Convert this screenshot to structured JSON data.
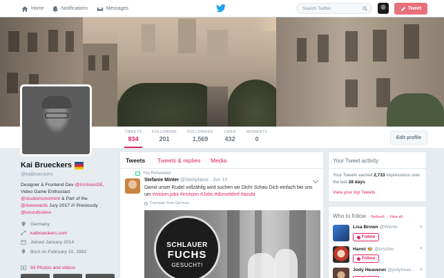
{
  "nav": {
    "home": "Home",
    "notifications": "Notifications",
    "messages": "Messages",
    "search_placeholder": "Search Twitter",
    "tweet_button": "Tweet"
  },
  "stats": [
    {
      "label": "TWEETS",
      "value": "834"
    },
    {
      "label": "FOLLOWING",
      "value": "201"
    },
    {
      "label": "FOLLOWERS",
      "value": "1,569"
    },
    {
      "label": "LIKES",
      "value": "432"
    },
    {
      "label": "MOMENTS",
      "value": "0"
    }
  ],
  "edit_profile": "Edit profile",
  "profile": {
    "name": "Kai Brueckers",
    "handle": "@kaibrueckers",
    "bio_1": "Designer & Frontend Dev ",
    "bio_link_1": "@InVisionDE",
    "bio_2": ", Video Game Enthusiast ",
    "bio_link_2": "@studiomonoment",
    "bio_3": " & Part of the ",
    "bio_link_3": "@Awwwards",
    "bio_4": " Jury 2017 /// Previously ",
    "bio_link_4": "@uxundtoilere",
    "location": "Germany",
    "website": "kaibrueckers.com",
    "joined": "Joined January 2014",
    "born": "Born on February 10, 1992",
    "photos": "93 Photos and videos"
  },
  "timeline": {
    "tabs": [
      "Tweets",
      "Tweets & replies",
      "Media"
    ],
    "retweeted": "You Retweeted",
    "tweet": {
      "author": "Stefanie Minter",
      "handle": "@Stehpfanni",
      "date": "Jun 13",
      "text_1": "Damit unser Rudel vollzählig wird suchen wir Dich! Schau Dich einfach bei uns um ",
      "link_1": "invision.jobs",
      "link_2": "#invision",
      "link_3": "#Jobs",
      "link_4": "#düsseldorf",
      "link_5": "#azubi",
      "translate": "Translate from German",
      "media_line_1": "SCHLAUER",
      "media_line_2": "FUCHS",
      "media_line_3": "GESUCHT!"
    }
  },
  "activity": {
    "title": "Your Tweet activity",
    "text_1": "Your Tweets earned ",
    "impressions": "2,733",
    "text_2": " impressions over the last ",
    "days": "28 days",
    "link": "View your top Tweets"
  },
  "who_to_follow": {
    "title": "Who to follow",
    "refresh": "· Refresh",
    "view_all": "· View all",
    "follow_label": "Follow",
    "suggestions": [
      {
        "name": "Lisa Brown",
        "handle": "@Wartle"
      },
      {
        "name": "Hanni 🐝",
        "handle": "@joschie"
      },
      {
        "name": "Jody Heavener",
        "handle": "@jodyheav..."
      }
    ]
  }
}
